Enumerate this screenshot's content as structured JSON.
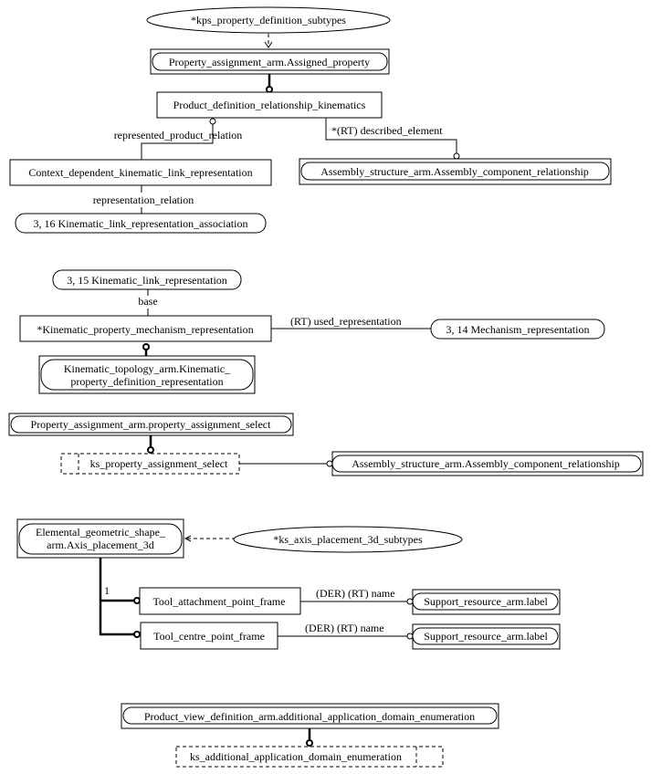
{
  "diagram": {
    "type": "EXPRESS-G",
    "nodes": {
      "kps_subtypes": {
        "label": "*kps_property_definition_subtypes",
        "kind": "ellipse"
      },
      "assigned_property": {
        "label": "Property_assignment_arm.Assigned_property",
        "kind": "reference"
      },
      "pdr_kinematics": {
        "label": "Product_definition_relationship_kinematics",
        "kind": "entity"
      },
      "cdklr": {
        "label": "Context_dependent_kinematic_link_representation",
        "kind": "entity"
      },
      "asm_comp_rel_1": {
        "label": "Assembly_structure_arm.Assembly_component_relationship",
        "kind": "reference"
      },
      "klra": {
        "label": "3, 16 Kinematic_link_representation_association",
        "kind": "page-ref"
      },
      "klr": {
        "label": "3, 15 Kinematic_link_representation",
        "kind": "page-ref"
      },
      "kpmr": {
        "label": "*Kinematic_property_mechanism_representation",
        "kind": "entity"
      },
      "mech_rep": {
        "label": "3, 14 Mechanism_representation",
        "kind": "page-ref"
      },
      "kpdr": {
        "label_line1": "Kinematic_topology_arm.Kinematic_",
        "label_line2": "property_definition_representation",
        "kind": "reference"
      },
      "pas": {
        "label": "Property_assignment_arm.property_assignment_select",
        "kind": "reference"
      },
      "ks_pas": {
        "label": "ks_property_assignment_select",
        "kind": "select"
      },
      "asm_comp_rel_2": {
        "label": "Assembly_structure_arm.Assembly_component_relationship",
        "kind": "reference"
      },
      "axis_placement": {
        "label_line1": "Elemental_geometric_shape_",
        "label_line2": "arm.Axis_placement_3d",
        "kind": "reference"
      },
      "ks_axis_subtypes": {
        "label": "*ks_axis_placement_3d_subtypes",
        "kind": "ellipse"
      },
      "tool_attach": {
        "label": "Tool_attachment_point_frame",
        "kind": "entity"
      },
      "tool_centre": {
        "label": "Tool_centre_point_frame",
        "kind": "entity"
      },
      "support_label_1": {
        "label": "Support_resource_arm.label",
        "kind": "reference"
      },
      "support_label_2": {
        "label": "Support_resource_arm.label",
        "kind": "reference"
      },
      "pvd_enum": {
        "label": "Product_view_definition_arm.additional_application_domain_enumeration",
        "kind": "reference"
      },
      "ks_enum": {
        "label": "ks_additional_application_domain_enumeration",
        "kind": "enumeration"
      }
    },
    "relations": {
      "represented_product_relation": "represented_product_relation",
      "described_element": "*(RT) described_element",
      "representation_relation": "representation_relation",
      "base": "base",
      "used_representation": "(RT) used_representation",
      "name_1": "(DER) (RT) name",
      "name_2": "(DER) (RT) name",
      "cardinality_1": "1"
    }
  }
}
